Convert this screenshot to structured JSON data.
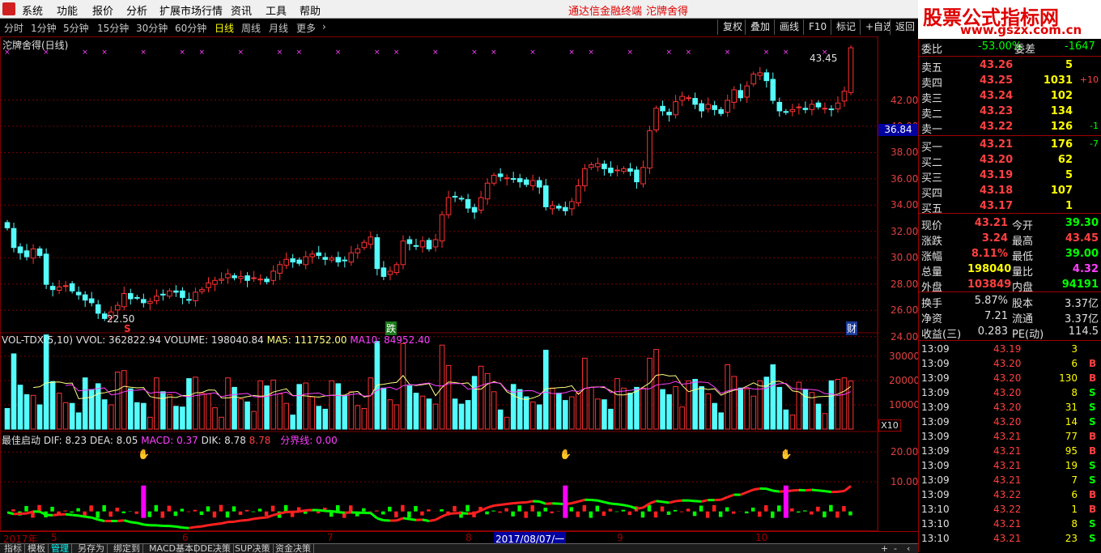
{
  "menu": {
    "items": [
      "系统",
      "功能",
      "报价",
      "分析",
      "扩展市场行情",
      "资讯",
      "工具",
      "帮助"
    ],
    "center_items": [
      "通达信金融终端",
      "沱牌舍得"
    ]
  },
  "brand": {
    "title": "股票公式指标网",
    "url": "www.gszx.com.cn"
  },
  "periods": [
    "分时",
    "1分钟",
    "5分钟",
    "15分钟",
    "30分钟",
    "60分钟",
    "日线",
    "周线",
    "月线",
    "更多"
  ],
  "active_period": "日线",
  "toolbar_buttons": [
    "复权",
    "叠加",
    "画线",
    "F10",
    "标记",
    "+自选",
    "返回"
  ],
  "stock_title": "沱牌舍得(日线)",
  "annotations": {
    "high": "43.45",
    "low": "22.50",
    "current": "36.84",
    "signal_s": "S",
    "signal_die": "跌",
    "signal_cai": "财"
  },
  "price_axis": [
    "42.00",
    "40.00",
    "38.00",
    "36.00",
    "34.00",
    "32.00",
    "30.00",
    "28.00",
    "26.00",
    "24.00"
  ],
  "vol_header": {
    "name": "VOL-TDX(5,10)",
    "vvol": "VVOL: 362822.94",
    "volume": "VOLUME: 198040.84",
    "ma5": "MA5: 111752.00",
    "ma10": "MA10: 84952.40"
  },
  "vol_axis": [
    "30000",
    "20000",
    "10000"
  ],
  "vol_unit": "X10",
  "ind_header": {
    "name": "最佳启动",
    "dif": "DIF: 8.23",
    "dea": "DEA: 8.05",
    "macd": "MACD: 0.37",
    "dik": "DIK: 8.78",
    "dik2": "8.78",
    "fen": "分界线: 0.00"
  },
  "ind_axis": [
    "20.00",
    "10.00"
  ],
  "date_axis": {
    "year": "2017年",
    "months": [
      "5",
      "6",
      "7",
      "8",
      "9",
      "10"
    ],
    "cursor_date": "2017/08/07/一"
  },
  "bottom_tabs": [
    "指标",
    "模板",
    "管理",
    "另存为",
    "绑定到",
    "MACD基本",
    "DDE决策",
    "SUP决策",
    "资金决策"
  ],
  "active_tab": "管理",
  "quote": {
    "top": {
      "label1": "委比",
      "val1": "-53.00%",
      "label2": "委差",
      "val2": "-1647"
    },
    "asks": [
      {
        "label": "卖五",
        "price": "43.26",
        "vol": "5",
        "chg": ""
      },
      {
        "label": "卖四",
        "price": "43.25",
        "vol": "1031",
        "chg": "+10"
      },
      {
        "label": "卖三",
        "price": "43.24",
        "vol": "102",
        "chg": ""
      },
      {
        "label": "卖二",
        "price": "43.23",
        "vol": "134",
        "chg": ""
      },
      {
        "label": "卖一",
        "price": "43.22",
        "vol": "126",
        "chg": "-1"
      }
    ],
    "bids": [
      {
        "label": "买一",
        "price": "43.21",
        "vol": "176",
        "chg": "-7"
      },
      {
        "label": "买二",
        "price": "43.20",
        "vol": "62",
        "chg": ""
      },
      {
        "label": "买三",
        "price": "43.19",
        "vol": "5",
        "chg": ""
      },
      {
        "label": "买四",
        "price": "43.18",
        "vol": "107",
        "chg": ""
      },
      {
        "label": "买五",
        "price": "43.17",
        "vol": "1",
        "chg": ""
      }
    ],
    "stats": [
      {
        "l1": "现价",
        "v1": "43.21",
        "l2": "今开",
        "v2": "39.30",
        "c1": "#ff4040",
        "c2": "#00ff00"
      },
      {
        "l1": "涨跌",
        "v1": "3.24",
        "l2": "最高",
        "v2": "43.45",
        "c1": "#ff4040",
        "c2": "#ff4040"
      },
      {
        "l1": "涨幅",
        "v1": "8.11%",
        "l2": "最低",
        "v2": "39.00",
        "c1": "#ff4040",
        "c2": "#00ff00"
      },
      {
        "l1": "总量",
        "v1": "198040",
        "l2": "量比",
        "v2": "4.32",
        "c1": "#ffff00",
        "c2": "#ff40ff"
      },
      {
        "l1": "外盘",
        "v1": "103849",
        "l2": "内盘",
        "v2": "94191",
        "c1": "#ff4040",
        "c2": "#00ff00"
      }
    ],
    "info": [
      {
        "l1": "换手",
        "v1": "5.87%",
        "l2": "股本",
        "v2": "3.37亿"
      },
      {
        "l1": "净资",
        "v1": "7.21",
        "l2": "流通",
        "v2": "3.37亿"
      },
      {
        "l1": "收益(三)",
        "v1": "0.283",
        "l2": "PE(动)",
        "v2": "114.5"
      }
    ],
    "ticks": [
      {
        "t": "13:09",
        "p": "43.19",
        "v": "3",
        "s": ""
      },
      {
        "t": "13:09",
        "p": "43.20",
        "v": "6",
        "s": "B"
      },
      {
        "t": "13:09",
        "p": "43.20",
        "v": "130",
        "s": "B"
      },
      {
        "t": "13:09",
        "p": "43.20",
        "v": "8",
        "s": "S"
      },
      {
        "t": "13:09",
        "p": "43.20",
        "v": "31",
        "s": "S"
      },
      {
        "t": "13:09",
        "p": "43.20",
        "v": "14",
        "s": "S"
      },
      {
        "t": "13:09",
        "p": "43.21",
        "v": "77",
        "s": "B"
      },
      {
        "t": "13:09",
        "p": "43.21",
        "v": "95",
        "s": "B"
      },
      {
        "t": "13:09",
        "p": "43.21",
        "v": "19",
        "s": "S"
      },
      {
        "t": "13:09",
        "p": "43.21",
        "v": "7",
        "s": "S"
      },
      {
        "t": "13:09",
        "p": "43.22",
        "v": "6",
        "s": "B"
      },
      {
        "t": "13:10",
        "p": "43.22",
        "v": "1",
        "s": "B"
      },
      {
        "t": "13:10",
        "p": "43.21",
        "v": "8",
        "s": "S"
      },
      {
        "t": "13:10",
        "p": "43.21",
        "v": "23",
        "s": "S"
      }
    ]
  },
  "colors": {
    "up": "#ff3232",
    "down": "#54fcfc",
    "grid": "#7a0000",
    "buy": "#ff4040",
    "sell": "#00ff00"
  },
  "chart_data": {
    "type": "candlestick",
    "closes": [
      29.5,
      28.0,
      27.6,
      27.3,
      27.9,
      27.4,
      25.2,
      24.8,
      25.0,
      25.1,
      24.7,
      24.4,
      24.0,
      23.8,
      23.0,
      22.6,
      23.1,
      23.6,
      24.5,
      24.1,
      24.2,
      23.8,
      23.9,
      24.3,
      24.4,
      24.7,
      24.6,
      24.2,
      24.0,
      24.6,
      24.8,
      25.3,
      25.5,
      25.6,
      26.0,
      25.7,
      25.8,
      25.5,
      25.7,
      25.6,
      25.4,
      26.2,
      26.7,
      27.1,
      26.9,
      26.8,
      27.3,
      27.5,
      27.4,
      27.1,
      27.2,
      26.9,
      27.0,
      27.6,
      27.9,
      28.4,
      28.8,
      26.4,
      25.8,
      26.2,
      26.7,
      28.5,
      28.3,
      28.1,
      28.5,
      27.9,
      28.6,
      30.5,
      31.8,
      31.9,
      31.7,
      31.0,
      30.7,
      31.8,
      32.9,
      33.5,
      33.4,
      33.3,
      33.2,
      33.0,
      32.8,
      33.1,
      32.6,
      31.1,
      31.2,
      31.0,
      30.8,
      31.5,
      32.7,
      34.0,
      34.3,
      34.4,
      34.0,
      33.7,
      33.9,
      34.0,
      33.8,
      33.0,
      34.1,
      36.9,
      38.6,
      38.4,
      38.1,
      39.1,
      39.5,
      39.4,
      38.9,
      38.4,
      38.9,
      38.5,
      38.2,
      39.2,
      40.0,
      39.4,
      40.3,
      41.2,
      41.3,
      40.7,
      39.2,
      38.4,
      38.3,
      38.5,
      38.7,
      38.5,
      38.9,
      38.7,
      38.6,
      38.5,
      39.0,
      39.9,
      43.2
    ],
    "ylim": [
      22.5,
      43.45
    ],
    "vol_ylim": [
      0,
      40000
    ],
    "ind_ylim": [
      -5,
      25
    ]
  }
}
